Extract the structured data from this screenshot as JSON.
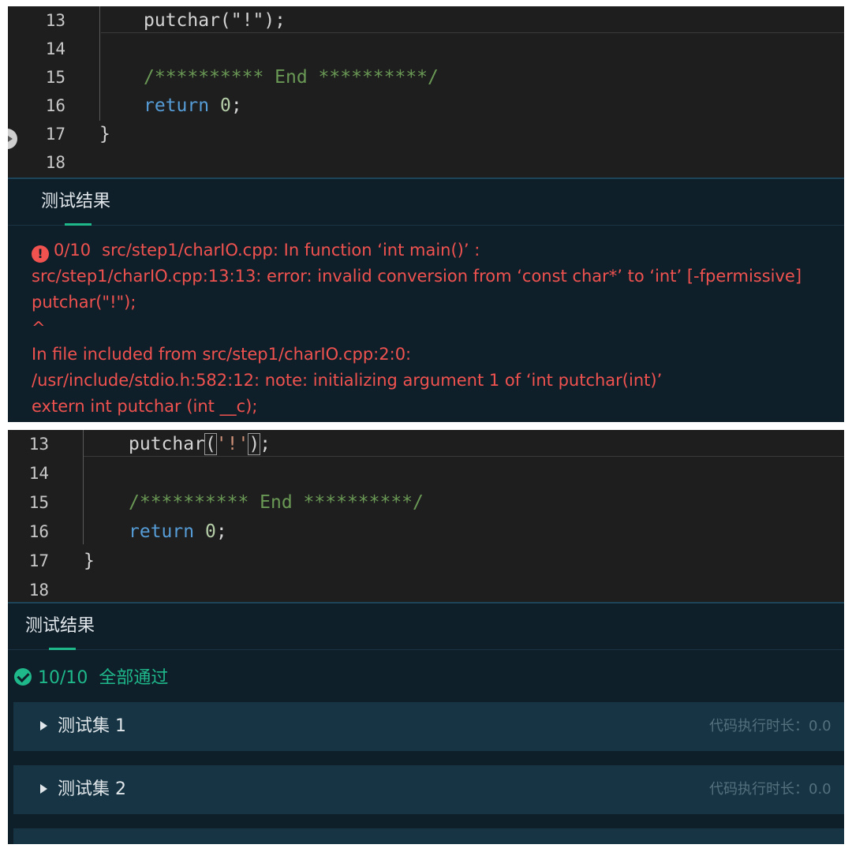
{
  "panel1": {
    "code_lines": [
      {
        "num": "13",
        "code": "putchar(\"!\");"
      },
      {
        "num": "14",
        "code": ""
      },
      {
        "num": "15",
        "comment": "/********** End **********/"
      },
      {
        "num": "16",
        "keyword": "return",
        "number": "0",
        "tail": ";"
      },
      {
        "num": "17",
        "code": "}"
      },
      {
        "num": "18",
        "code": ""
      }
    ],
    "results_tab": "测试结果",
    "error": {
      "score": "0/10",
      "lines": [
        "src/step1/charIO.cpp: In function   ‘int main()’ :",
        "src/step1/charIO.cpp:13:13: error: invalid conversion from   ‘const char*’   to   ‘int’   [-fpermissive]",
        "putchar(\"!\");",
        "^",
        "In file included from src/step1/charIO.cpp:2:0:",
        "/usr/include/stdio.h:582:12: note: initializing argument 1 of   ‘int putchar(int)’",
        "extern int putchar (int __c);"
      ]
    }
  },
  "panel2": {
    "code_lines": [
      {
        "num": "13",
        "fn": "putchar",
        "open": "(",
        "arg": "'!'",
        "close": ")",
        "tail": ";"
      },
      {
        "num": "14",
        "code": ""
      },
      {
        "num": "15",
        "comment": "/********** End **********/"
      },
      {
        "num": "16",
        "keyword": "return",
        "number": "0",
        "tail": ";"
      },
      {
        "num": "17",
        "code": "}"
      },
      {
        "num": "18",
        "code": ""
      }
    ],
    "results_tab": "测试结果",
    "pass": {
      "score": "10/10",
      "label": "全部通过"
    },
    "suites": [
      {
        "name": "测试集 1",
        "time": "代码执行时长：0.0"
      },
      {
        "name": "测试集 2",
        "time": "代码执行时长：0.0"
      }
    ]
  },
  "colors": {
    "error": "#f0524f",
    "success": "#1fb88a",
    "keyword": "#569cd6",
    "comment": "#6a9955"
  }
}
